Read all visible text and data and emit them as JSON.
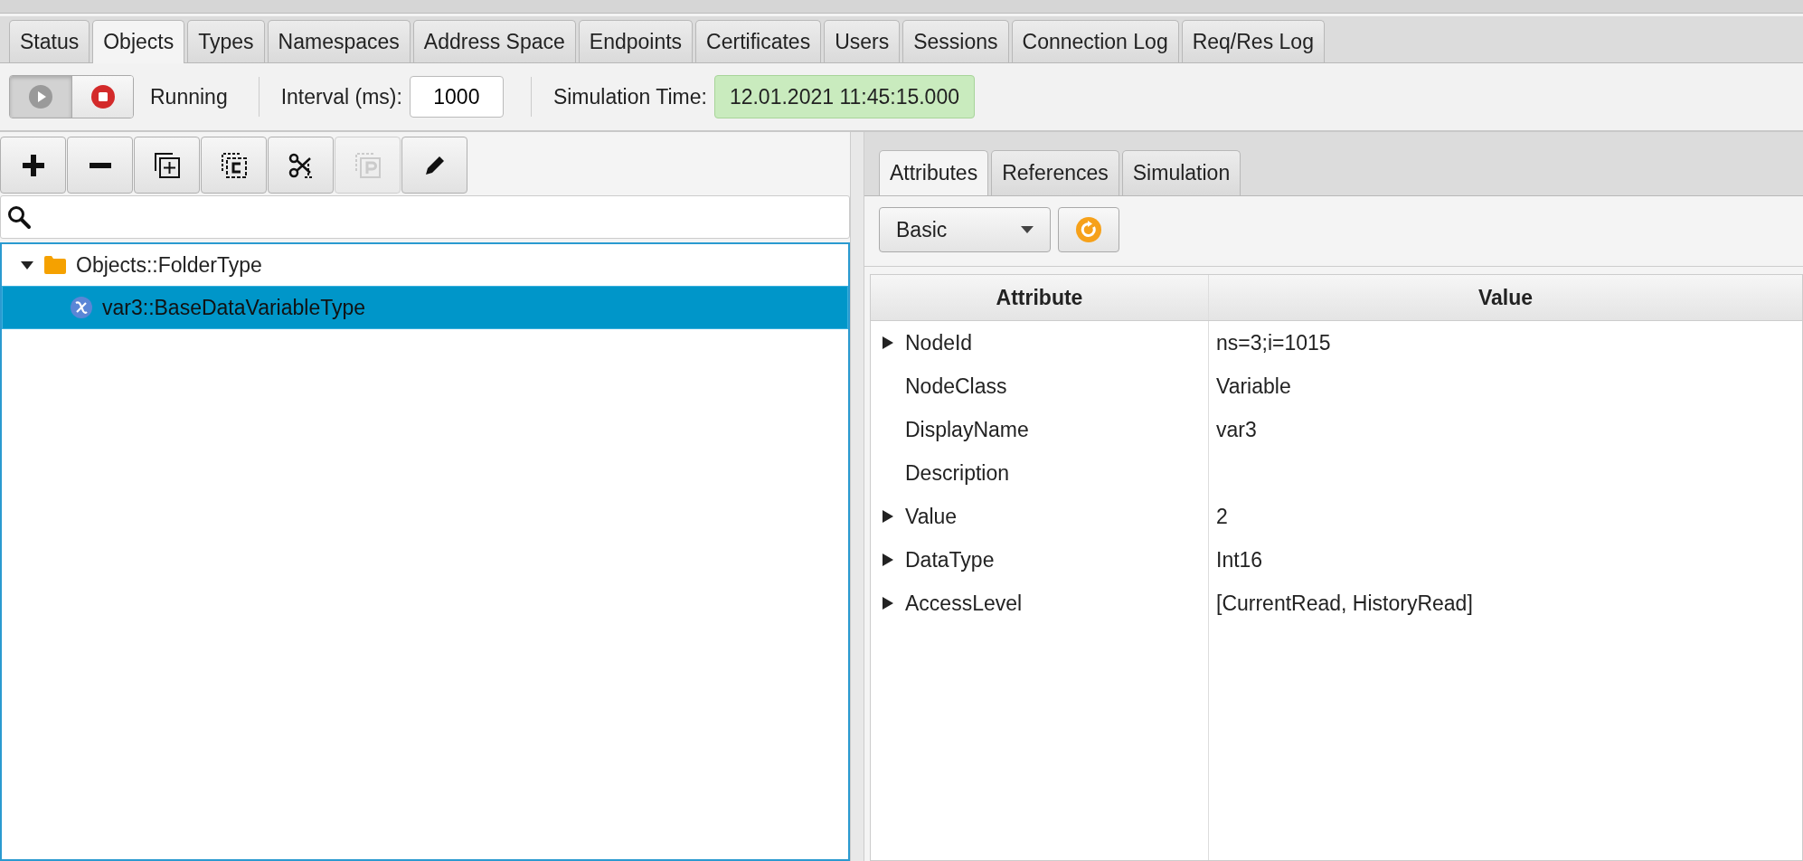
{
  "tabs": [
    {
      "label": "Status",
      "selected": false
    },
    {
      "label": "Objects",
      "selected": true
    },
    {
      "label": "Types",
      "selected": false
    },
    {
      "label": "Namespaces",
      "selected": false
    },
    {
      "label": "Address Space",
      "selected": false
    },
    {
      "label": "Endpoints",
      "selected": false
    },
    {
      "label": "Certificates",
      "selected": false
    },
    {
      "label": "Users",
      "selected": false
    },
    {
      "label": "Sessions",
      "selected": false
    },
    {
      "label": "Connection Log",
      "selected": false
    },
    {
      "label": "Req/Res Log",
      "selected": false
    }
  ],
  "simulation_bar": {
    "controls": [
      {
        "kind": "play",
        "selected": true
      },
      {
        "kind": "stop",
        "selected": false
      }
    ],
    "state": "Running",
    "interval_label": "Interval (ms):",
    "interval_value": "1000",
    "time_label": "Simulation Time:",
    "time_value": "12.01.2021 11:45:15.000"
  },
  "node_toolbar": [
    {
      "kind": "add",
      "disabled": false
    },
    {
      "kind": "remove",
      "disabled": false
    },
    {
      "kind": "duplicate",
      "disabled": false
    },
    {
      "kind": "copy",
      "disabled": false
    },
    {
      "kind": "cut",
      "disabled": false
    },
    {
      "kind": "paste",
      "disabled": true
    },
    {
      "kind": "edit",
      "disabled": false
    }
  ],
  "tree": [
    {
      "label": "Objects::FolderType",
      "kind": "folder",
      "expanded": true,
      "selected": false,
      "children": [
        {
          "label": "var3::BaseDataVariableType",
          "kind": "variable",
          "selected": true
        }
      ]
    }
  ],
  "detail_tabs": [
    {
      "label": "Attributes",
      "selected": true
    },
    {
      "label": "References",
      "selected": false
    },
    {
      "label": "Simulation",
      "selected": false
    }
  ],
  "view_selector": "Basic",
  "table": {
    "columns": [
      "Attribute",
      "Value"
    ],
    "rows": [
      {
        "attribute": "NodeId",
        "value": "ns=3;i=1015",
        "expandable": true
      },
      {
        "attribute": "NodeClass",
        "value": "Variable",
        "expandable": false
      },
      {
        "attribute": "DisplayName",
        "value": "var3",
        "expandable": false
      },
      {
        "attribute": "Description",
        "expandable": false
      },
      {
        "attribute": "Value",
        "value": "2",
        "expandable": true
      },
      {
        "attribute": "DataType",
        "value": "Int16",
        "expandable": true
      },
      {
        "attribute": "AccessLevel",
        "value": "[CurrentRead, HistoryRead]",
        "expandable": true
      }
    ]
  }
}
